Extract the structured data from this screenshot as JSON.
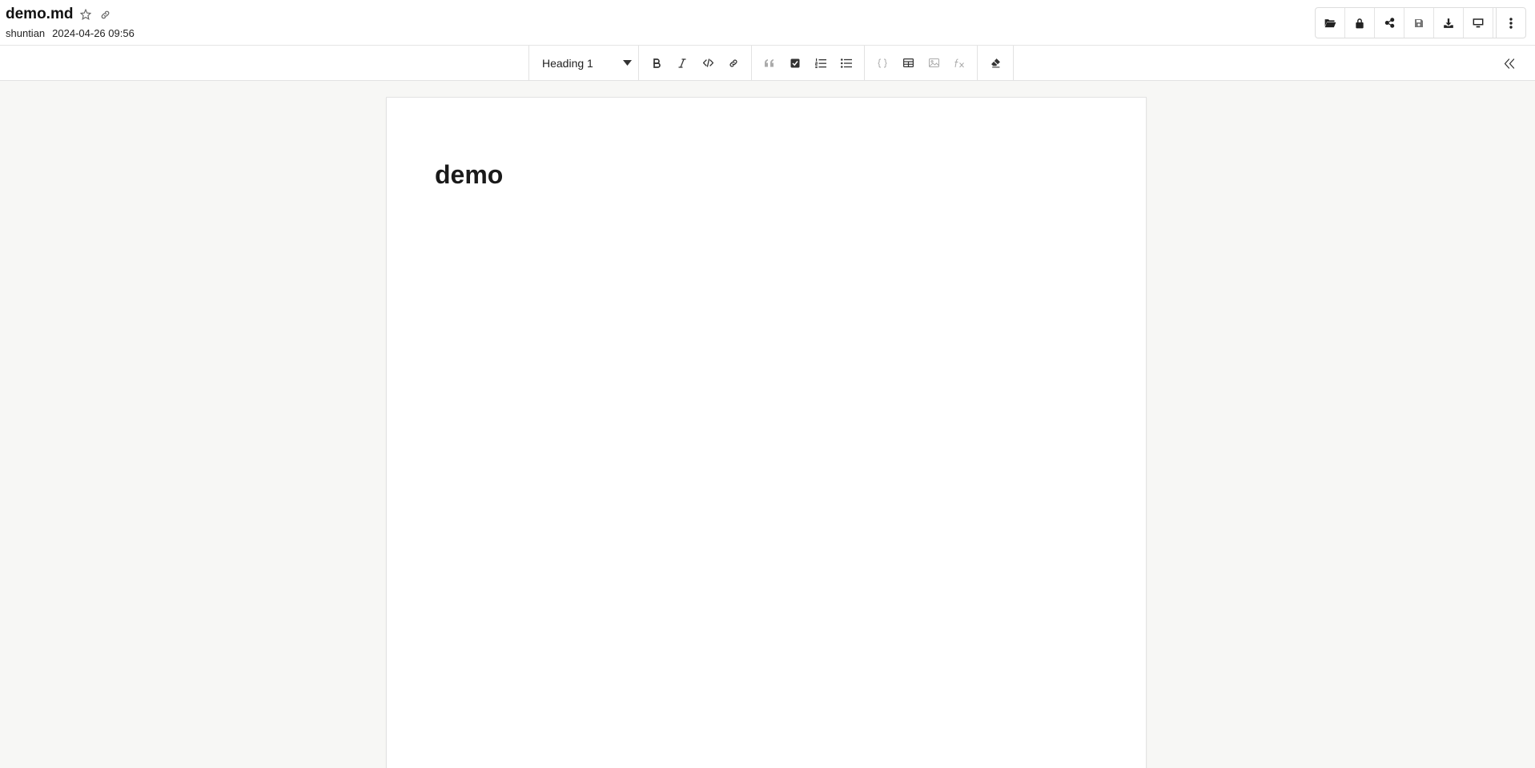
{
  "document": {
    "title": "demo.md",
    "author": "shuntian",
    "timestamp": "2024-04-26 09:56",
    "heading": "demo"
  },
  "toolbar": {
    "block_type": "Heading 1"
  },
  "icons": {
    "favorite": "star-icon",
    "link": "link-icon",
    "open": "folder-open-icon",
    "lock": "lock-icon",
    "share": "share-icon",
    "save": "save-icon",
    "download": "download-icon",
    "present": "monitor-icon",
    "more": "more-vertical-icon",
    "collapse": "double-chevron-left-icon"
  },
  "colors": {
    "background": "#f7f7f5",
    "surface": "#ffffff",
    "border": "#e2e2e2",
    "text": "#222222",
    "disabled": "#aaaaaa"
  }
}
